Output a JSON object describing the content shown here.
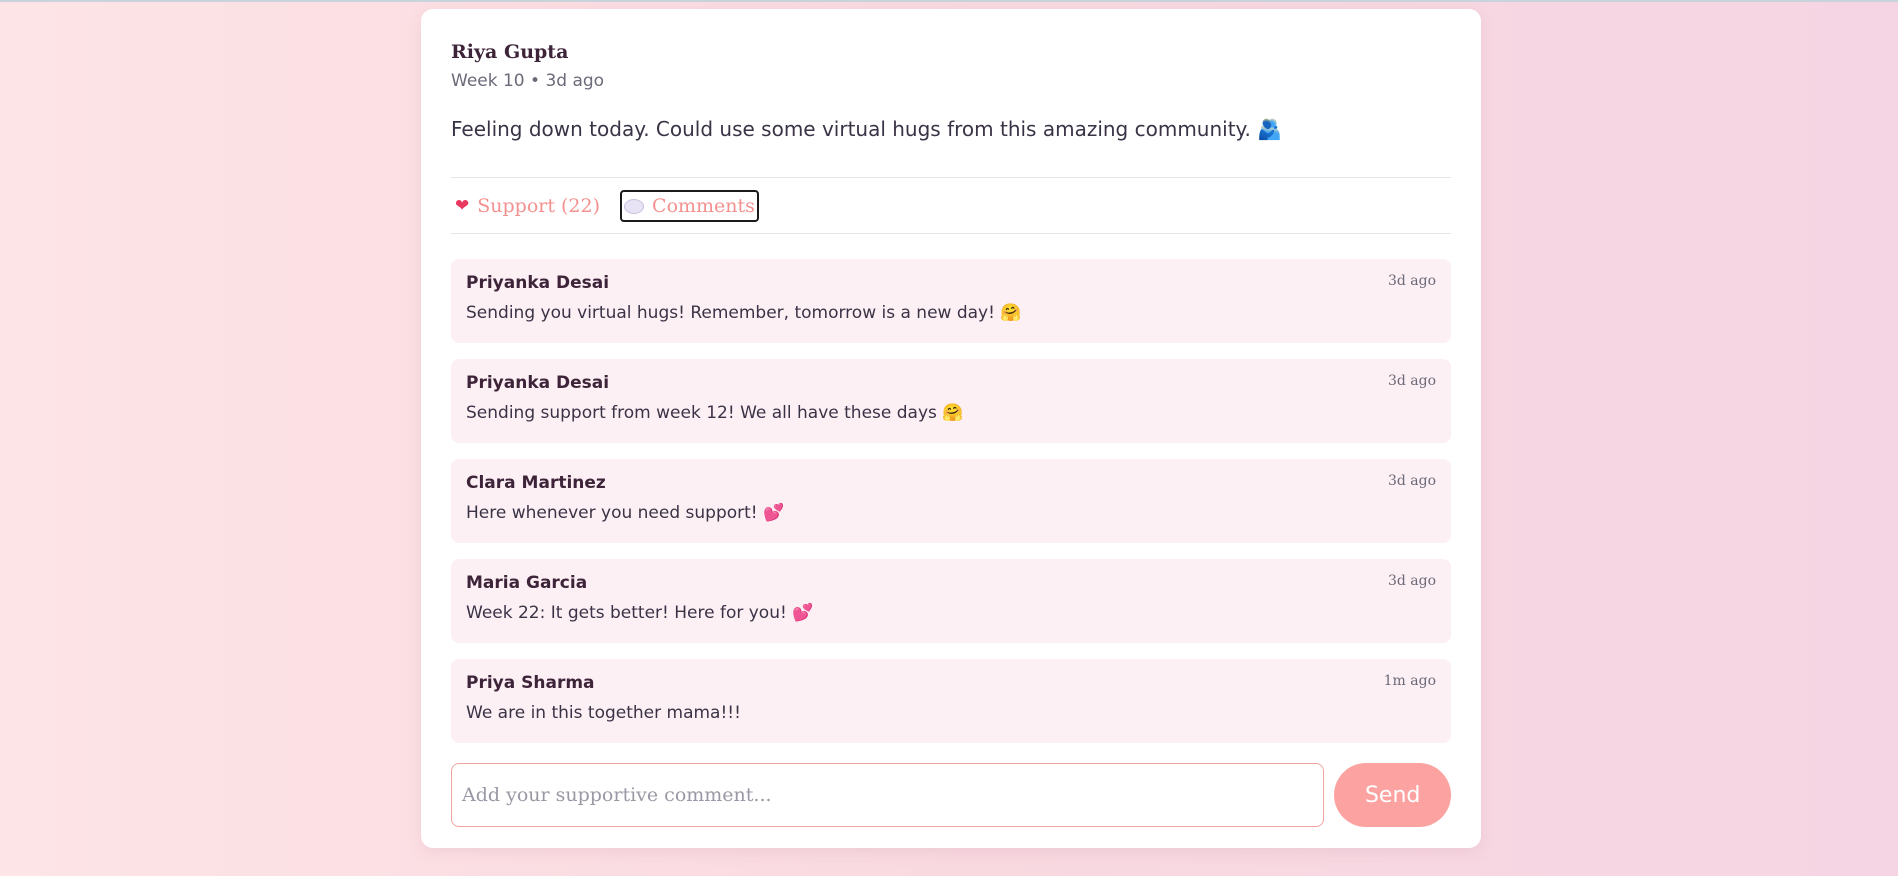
{
  "post": {
    "author": "Riya Gupta",
    "meta": "Week 10 • 3d ago",
    "text": "Feeling down today. Could use some virtual hugs from this amazing community. 🫂"
  },
  "actions": {
    "support_icon": "heart-icon",
    "support_label": "Support (22)",
    "comments_icon": "speech-bubble-icon",
    "comments_label": "Comments"
  },
  "comments": [
    {
      "name": "Priyanka Desai",
      "time": "3d ago",
      "text": "Sending you virtual hugs! Remember, tomorrow is a new day! 🤗"
    },
    {
      "name": "Priyanka Desai",
      "time": "3d ago",
      "text": "Sending support from week 12! We all have these days 🤗"
    },
    {
      "name": "Clara Martinez",
      "time": "3d ago",
      "text": "Here whenever you need support! 💕"
    },
    {
      "name": "Maria Garcia",
      "time": "3d ago",
      "text": "Week 22: It gets better! Here for you! 💕"
    },
    {
      "name": "Priya Sharma",
      "time": "1m ago",
      "text": "We are in this together mama!!!"
    }
  ],
  "composer": {
    "placeholder": "Add your supportive comment...",
    "value": "",
    "send_label": "Send"
  },
  "colors": {
    "accent": "#f39190",
    "send_button": "#fca3a2",
    "comment_bg": "#fdf0f5"
  }
}
